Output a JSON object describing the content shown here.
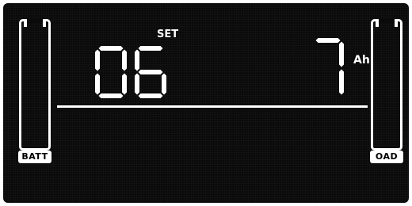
{
  "display": {
    "mode_label": "SET",
    "item_code": "06",
    "value": "7",
    "unit": "Ah"
  },
  "battery_gauge": {
    "label": "BATT",
    "level_fraction": 0
  },
  "load_gauge": {
    "label": "OAD",
    "level_fraction": 0
  },
  "colors": {
    "segment": "#ffffff",
    "background": "#0a0a0a"
  }
}
